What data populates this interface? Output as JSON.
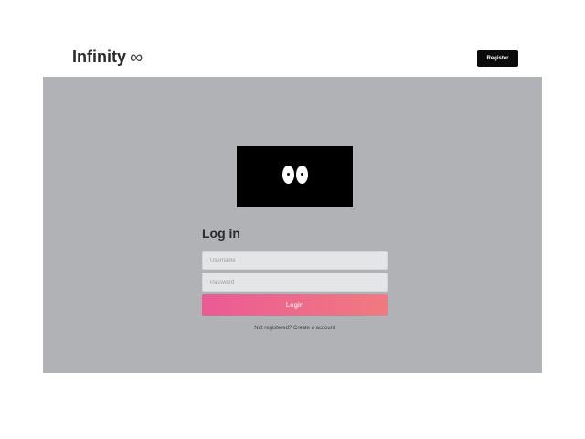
{
  "header": {
    "brand_name": "Infinity",
    "brand_symbol": "∞",
    "register_label": "Register"
  },
  "login_form": {
    "title": "Log in",
    "username_placeholder": "Username",
    "password_placeholder": "Password",
    "login_label": "Login",
    "signup_text": "Not registered? Create a account"
  },
  "colors": {
    "panel_background": "#b0b2b5",
    "login_gradient_start": "#ec5a95",
    "login_gradient_end": "#f07a80",
    "register_background": "#0b0b0b"
  },
  "icons": {
    "mascot": "eyes-icon"
  }
}
